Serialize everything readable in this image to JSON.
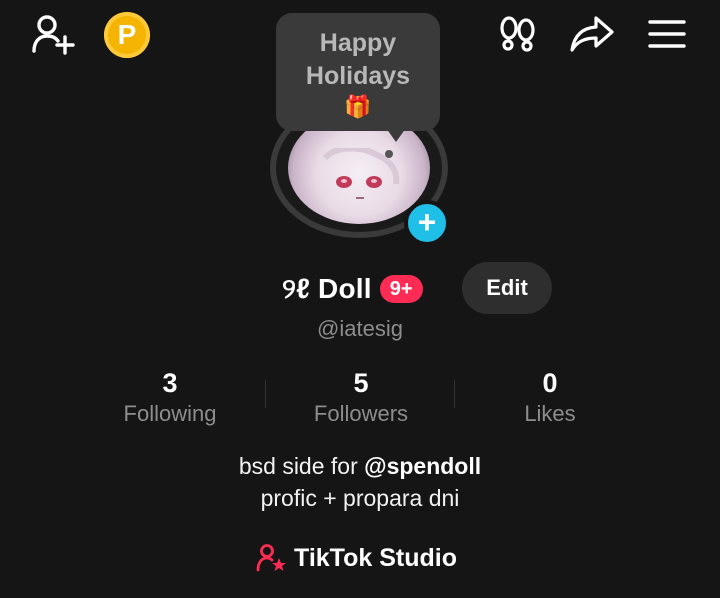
{
  "header": {
    "coin_letter": "P",
    "icons": [
      "add-friend-icon",
      "coin-icon",
      "footprint-icon",
      "share-icon",
      "menu-icon"
    ]
  },
  "tooltip": {
    "line1": "Happy",
    "line2": "Holidays",
    "emoji": "🎁"
  },
  "profile": {
    "display_name_prefix": "୨ℓ",
    "display_name": "Doll",
    "badge": "9+",
    "edit_label": "Edit",
    "username": "@iatesig"
  },
  "stats": [
    {
      "value": "3",
      "label": "Following"
    },
    {
      "value": "5",
      "label": "Followers"
    },
    {
      "value": "0",
      "label": "Likes"
    }
  ],
  "bio": {
    "line1_prefix": "bsd side for ",
    "line1_mention": "@spendoll",
    "line2": "profic + propara dni"
  },
  "studio": {
    "label": "TikTok Studio"
  },
  "colors": {
    "background": "#151515",
    "accent_red": "#fe2c55",
    "accent_blue": "#20bfe7",
    "coin": "#f4b400"
  }
}
